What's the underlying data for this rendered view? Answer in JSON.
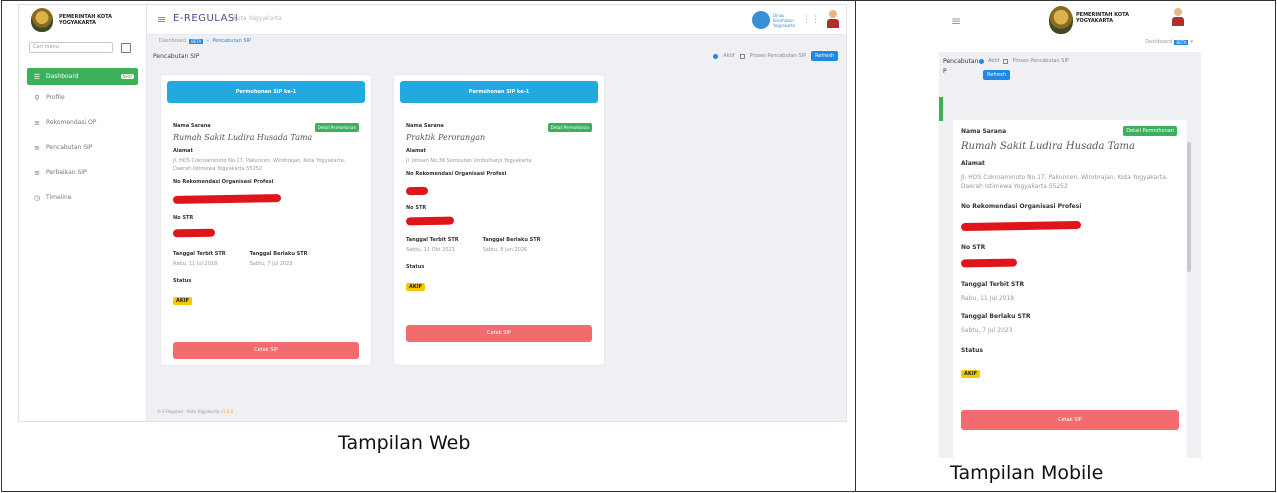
{
  "captions": {
    "web": "Tampilan Web",
    "mobile": "Tampilan Mobile"
  },
  "web": {
    "logo": {
      "line1": "PEMERINTAH KOTA",
      "line2": "YOGYAKARTA"
    },
    "search_placeholder": "Cari menu",
    "sidebar": [
      {
        "label": "Dashboard",
        "badge": "NEW",
        "active": true
      },
      {
        "label": "Profile"
      },
      {
        "label": "Rekomendasi OP"
      },
      {
        "label": "Pencabutan SIP"
      },
      {
        "label": "Perbaikan SIP"
      },
      {
        "label": "Timeline"
      }
    ],
    "header": {
      "title": "E-REGULASI",
      "subtitle": "Kota Yogyakarta",
      "partner": [
        "Dinas",
        "Kesehatan",
        "Yogyakarta"
      ]
    },
    "breadcrumb": {
      "first": "Dashboard",
      "tag": "BETA",
      "sep": "»",
      "current": "Pencabutan SIP"
    },
    "page_title": "Pencabutan SIP",
    "controls": {
      "radio_label": "Aktif",
      "check_label": "Proses Pencabutan SIP",
      "button": "Refresh"
    },
    "cards": [
      {
        "header": "Permohonan SIP ke-1",
        "status_button": "Detail Permohonan",
        "facility_label": "Nama Sarana",
        "facility_value": "Rumah Sakit Ludira Husada Tama",
        "address_label": "Alamat",
        "address_value": "Jl. HOS Cokroaminoto No.17, Pakuncen, Wirobrajan, Kota Yogyakarta, Daerah Istimewa Yogyakarta 55252",
        "rekomendasi_label": "No Rekomendasi Organisasi Profesi",
        "str_label": "No STR",
        "tgl_terbit_label": "Tanggal Terbit STR",
        "tgl_terbit_value": "Rabu, 11 Jul 2018",
        "tgl_berlaku_label": "Tanggal Berlaku STR",
        "tgl_berlaku_value": "Sabtu, 7 Jul 2023",
        "status_label": "Status",
        "status_value": "AKIF",
        "print_button": "Cetak SIP"
      },
      {
        "header": "Permohonan SIP ke-1",
        "status_button": "Detail Permohonan",
        "facility_label": "Nama Sarana",
        "facility_value": "Praktik Perorangan",
        "address_label": "Alamat",
        "address_value": "Jl. Jetisan No.36 Sorosutan Umbulharjo Yogyakarta",
        "rekomendasi_label": "No Rekomendasi Organisasi Profesi",
        "str_label": "No STR",
        "tgl_terbit_label": "Tanggal Terbit STR",
        "tgl_terbit_value": "Sabtu, 11 Okt 2021",
        "tgl_berlaku_label": "Tanggal Berlaku STR",
        "tgl_berlaku_value": "Sabtu, 8 Jun 2026",
        "status_label": "Status",
        "status_value": "AKIF",
        "print_button": "Cetak SIP"
      }
    ],
    "footer": {
      "text": "© E-Regulasi - Kota Yogyakarta",
      "link": "v1.0.0"
    }
  },
  "mobile": {
    "logo": {
      "line1": "PEMERINTAH KOTA",
      "line2": "YOGYAKARTA"
    },
    "breadcrumb": {
      "first": "Dashboard",
      "tag": "BETA"
    },
    "page_title": "Pencabutan",
    "page_title_2": "P",
    "controls": {
      "radio_label": "Aktif",
      "check_label": "Proses Pencabutan SIP",
      "button": "Refresh"
    },
    "card": {
      "status_button": "Detail Permohonan",
      "facility_label": "Nama Sarana",
      "facility_value": "Rumah Sakit Ludira Husada Tama",
      "address_label": "Alamat",
      "address_value": "Jl. HOS Cokroaminoto No.17, Pakuncen, Wirobrajan, Kota Yogyakarta, Daerah Istimewa Yogyakarta 55252",
      "rekomendasi_label": "No Rekomendasi Organisasi Profesi",
      "str_label": "No STR",
      "tgl_terbit_label": "Tanggal Terbit STR",
      "tgl_terbit_value": "Rabu, 11 Jul 2018",
      "tgl_berlaku_label": "Tanggal Berlaku STR",
      "tgl_berlaku_value": "Sabtu, 7 Jul 2023",
      "status_label": "Status",
      "status_value": "AKIF",
      "print_button": "Cetak SIP"
    }
  },
  "colors": {
    "accent_green": "#3cb05a",
    "header_blue": "#22a9e0",
    "print_red": "#f26c6f",
    "status_yellow": "#f5c800",
    "redaction": "#e0141b"
  }
}
